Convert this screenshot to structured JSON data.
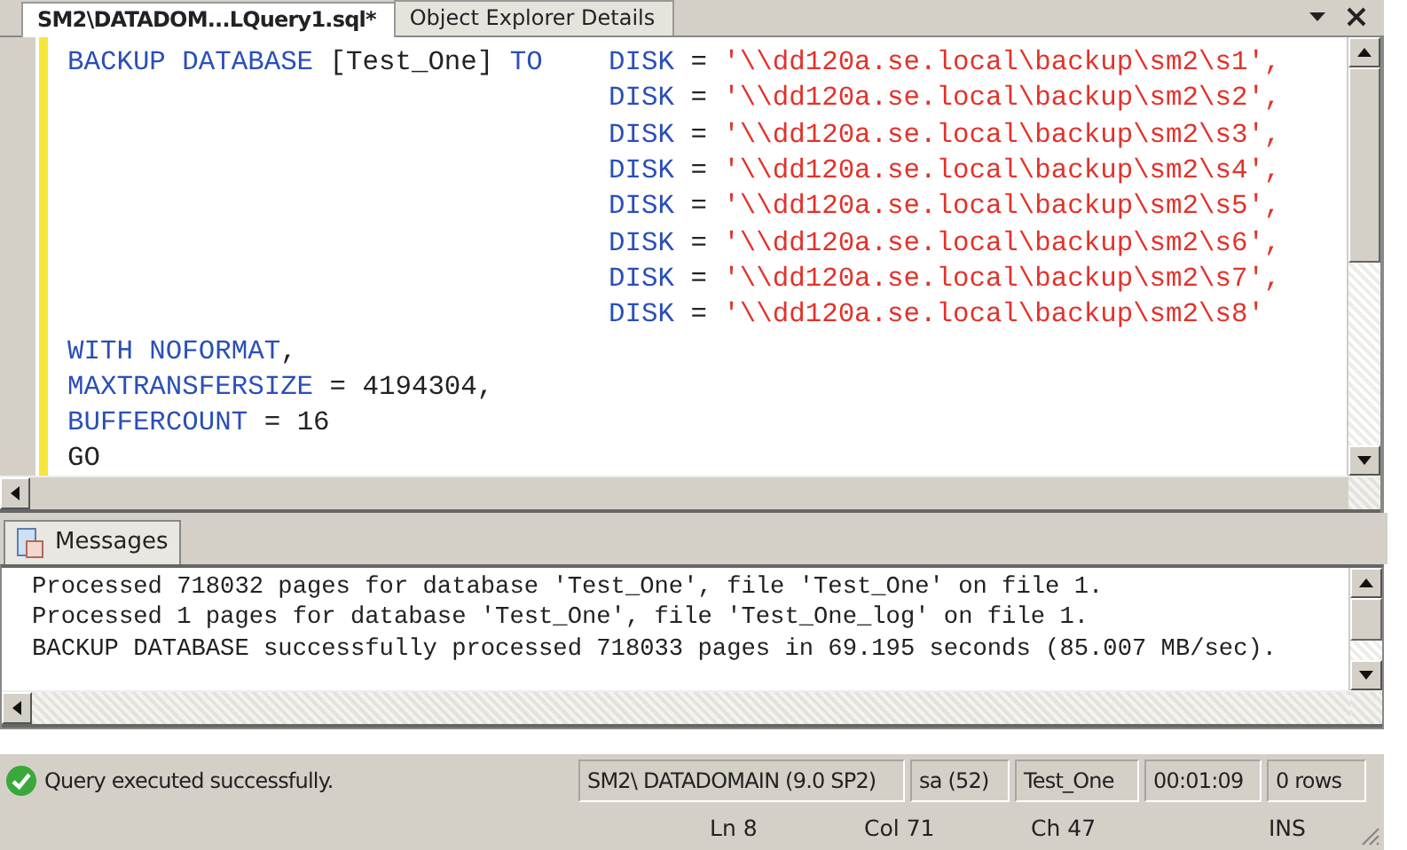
{
  "tabs": [
    {
      "label": "SM2\\DATADOM...LQuery1.sql*",
      "selected": true
    },
    {
      "label": "Object Explorer Details",
      "selected": false
    }
  ],
  "editor": {
    "lines": [
      {
        "left": [
          {
            "kind": "keyword",
            "text": "BACKUP DATABASE "
          },
          {
            "kind": "plain",
            "text": "[Test_One] "
          },
          {
            "kind": "keyword",
            "text": "TO"
          }
        ],
        "right": [
          {
            "kind": "keyword",
            "text": "DISK "
          },
          {
            "kind": "plain",
            "text": "= "
          },
          {
            "kind": "string",
            "text": "'\\\\dd120a.se.local\\backup\\sm2\\s1',"
          }
        ]
      },
      {
        "right": [
          {
            "kind": "keyword",
            "text": "DISK "
          },
          {
            "kind": "plain",
            "text": "= "
          },
          {
            "kind": "string",
            "text": "'\\\\dd120a.se.local\\backup\\sm2\\s2',"
          }
        ]
      },
      {
        "right": [
          {
            "kind": "keyword",
            "text": "DISK "
          },
          {
            "kind": "plain",
            "text": "= "
          },
          {
            "kind": "string",
            "text": "'\\\\dd120a.se.local\\backup\\sm2\\s3',"
          }
        ]
      },
      {
        "right": [
          {
            "kind": "keyword",
            "text": "DISK "
          },
          {
            "kind": "plain",
            "text": "= "
          },
          {
            "kind": "string",
            "text": "'\\\\dd120a.se.local\\backup\\sm2\\s4',"
          }
        ]
      },
      {
        "right": [
          {
            "kind": "keyword",
            "text": "DISK "
          },
          {
            "kind": "plain",
            "text": "= "
          },
          {
            "kind": "string",
            "text": "'\\\\dd120a.se.local\\backup\\sm2\\s5',"
          }
        ]
      },
      {
        "right": [
          {
            "kind": "keyword",
            "text": "DISK "
          },
          {
            "kind": "plain",
            "text": "= "
          },
          {
            "kind": "string",
            "text": "'\\\\dd120a.se.local\\backup\\sm2\\s6',"
          }
        ]
      },
      {
        "right": [
          {
            "kind": "keyword",
            "text": "DISK "
          },
          {
            "kind": "plain",
            "text": "= "
          },
          {
            "kind": "string",
            "text": "'\\\\dd120a.se.local\\backup\\sm2\\s7',"
          }
        ]
      },
      {
        "right": [
          {
            "kind": "keyword",
            "text": "DISK "
          },
          {
            "kind": "plain",
            "text": "= "
          },
          {
            "kind": "string",
            "text": "'\\\\dd120a.se.local\\backup\\sm2\\s8'"
          }
        ]
      },
      {
        "left": [
          {
            "kind": "keyword",
            "text": "WITH NOFORMAT"
          },
          {
            "kind": "plain",
            "text": ","
          }
        ]
      },
      {
        "left": [
          {
            "kind": "keyword",
            "text": "MAXTRANSFERSIZE "
          },
          {
            "kind": "plain",
            "text": "= 4194304,"
          }
        ]
      },
      {
        "left": [
          {
            "kind": "keyword",
            "text": "BUFFERCOUNT "
          },
          {
            "kind": "plain",
            "text": "= 16"
          }
        ]
      },
      {
        "left": [
          {
            "kind": "plain",
            "text": "GO"
          }
        ]
      }
    ]
  },
  "results": {
    "tab": "Messages",
    "lines": [
      "Processed 718032 pages for database 'Test_One', file 'Test_One' on file 1.",
      "Processed 1 pages for database 'Test_One', file 'Test_One_log' on file 1.",
      "BACKUP DATABASE successfully processed 718033 pages in 69.195 seconds (85.007 MB/sec)."
    ]
  },
  "status_bar": {
    "message": "Query executed successfully.",
    "cells": [
      "SM2\\ DATADOMAIN (9.0 SP2)",
      "sa (52)",
      "Test_One",
      "00:01:09",
      "0 rows"
    ]
  },
  "position_bar": [
    "Ln 8",
    "Col 71",
    "Ch 47",
    "INS"
  ]
}
